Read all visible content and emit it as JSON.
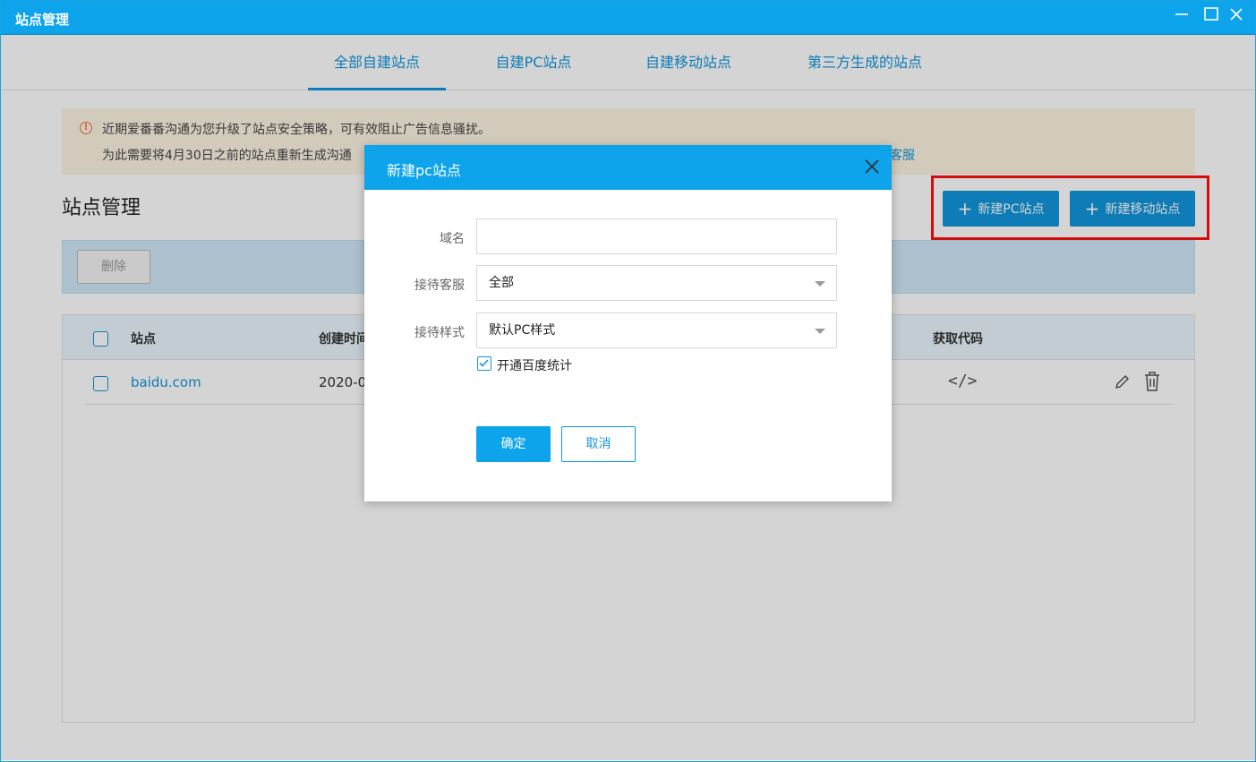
{
  "window": {
    "title": "站点管理"
  },
  "tabs": [
    {
      "label": "全部自建站点",
      "active": true
    },
    {
      "label": "自建PC站点"
    },
    {
      "label": "自建移动站点"
    },
    {
      "label": "第三方生成的站点"
    }
  ],
  "notice": {
    "line1": "近期爱番番沟通为您升级了站点安全策略，可有效阻止广告信息骚扰。",
    "line2": "为此需要将4月30日之前的站点重新生成沟通",
    "line2_tail": "客服"
  },
  "page": {
    "title": "站点管理",
    "new_pc_label": "新建PC站点",
    "new_mobile_label": "新建移动站点",
    "delete_label": "删除"
  },
  "table": {
    "headers": {
      "site": "站点",
      "created": "创建时间",
      "code": "获取代码"
    },
    "rows": [
      {
        "site": "baidu.com",
        "created": "2020-0"
      }
    ]
  },
  "dialog": {
    "title": "新建pc站点",
    "domain_label": "域名",
    "domain_value": "",
    "service_label": "接待客服",
    "service_value": "全部",
    "style_label": "接待样式",
    "style_value": "默认PC样式",
    "baidu_stats_label": "开通百度统计",
    "baidu_stats_checked": true,
    "ok_label": "确定",
    "cancel_label": "取消"
  },
  "colors": {
    "brand": "#0da4ec",
    "link": "#1296db",
    "highlight": "#ff1010"
  }
}
